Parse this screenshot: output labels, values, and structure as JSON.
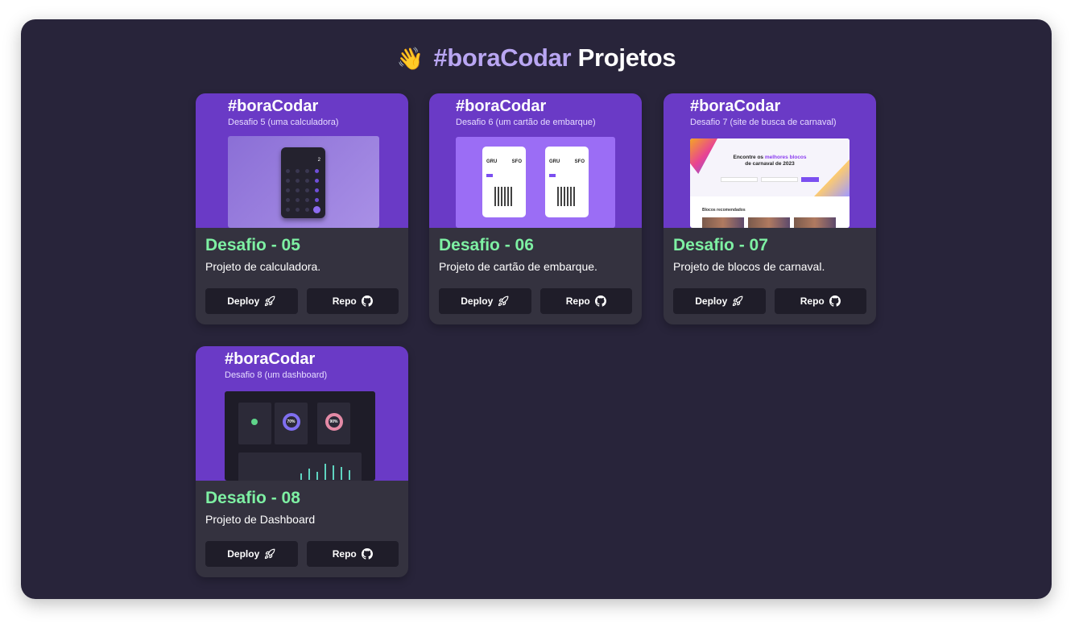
{
  "header": {
    "wave_emoji": "👋",
    "title_accent": "#boraCodar",
    "title_rest": "Projetos"
  },
  "colors": {
    "background": "#28243a",
    "card": "#34323f",
    "accent_purple": "#b9a6f2",
    "title_green": "#7ef0a3",
    "button": "#1f1d29",
    "thumb_purple": "#6a3ac6"
  },
  "cards": [
    {
      "thumb_brand": "#boraCodar",
      "thumb_sub": "Desafio 5 (uma calculadora)",
      "title": "Desafio - 05",
      "description": "Projeto de calculadora.",
      "deploy_label": "Deploy",
      "repo_label": "Repo",
      "calc_display": "2"
    },
    {
      "thumb_brand": "#boraCodar",
      "thumb_sub": "Desafio 6 (um cartão de embarque)",
      "title": "Desafio - 06",
      "description": "Projeto de cartão de embarque.",
      "deploy_label": "Deploy",
      "repo_label": "Repo",
      "from": "GRU",
      "to": "SFO"
    },
    {
      "thumb_brand": "#boraCodar",
      "thumb_sub": "Desafio 7 (site de busca de carnaval)",
      "title": "Desafio - 07",
      "description": "Projeto de blocos de carnaval.",
      "deploy_label": "Deploy",
      "repo_label": "Repo",
      "hero_line1": "Encontre os",
      "hero_highlight": "melhores blocos",
      "hero_line2": "de carnaval de 2023",
      "section_label": "Blocos recomendados"
    },
    {
      "thumb_brand": "#boraCodar",
      "thumb_sub": "Desafio 8 (um dashboard)",
      "title": "Desafio - 08",
      "description": "Projeto de Dashboard",
      "deploy_label": "Deploy",
      "repo_label": "Repo",
      "ring1": "70%",
      "ring2": "90%"
    }
  ],
  "icons": {
    "deploy": "rocket-icon",
    "repo": "github-icon"
  }
}
